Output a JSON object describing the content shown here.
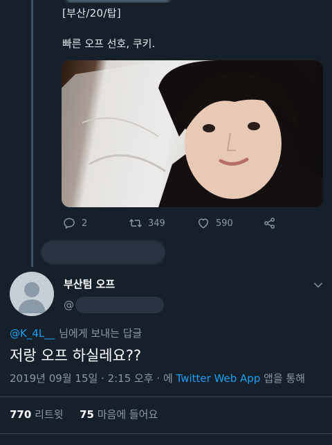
{
  "parent_tweet": {
    "tag_line": "[부산/20/탑]",
    "text": "빠른 오프 선호, 쿠키.",
    "actions": {
      "reply_count": "2",
      "retweet_count": "349",
      "like_count": "590"
    }
  },
  "reply_tweet": {
    "display_name": "부산텀 오프",
    "handle_prefix": "@",
    "reply_to_handle": "@K_4L__",
    "reply_to_suffix": "님에게 보내는 답글",
    "text": "저랑 오프 하실레요??",
    "timestamp": "2019년 09월 15일 · 2:15 오후 · 에",
    "app_name": "Twitter Web App",
    "app_suffix": "앱을 통해",
    "retweet_count": "770",
    "retweet_label": "리트윗",
    "like_count": "75",
    "like_label": "마음에 들어요"
  },
  "colors": {
    "background": "#15202b",
    "accent": "#1da1f2",
    "muted": "#8899a6"
  }
}
